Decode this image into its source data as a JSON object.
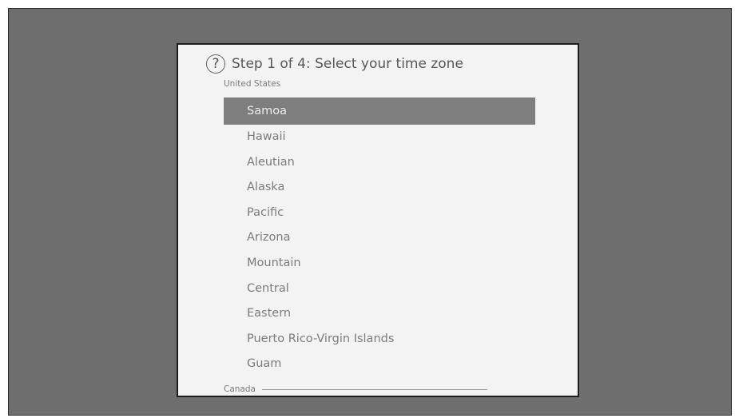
{
  "dialog": {
    "title": "Step 1 of 4: Select your time zone",
    "help_symbol": "?",
    "help_icon": "question-circle-icon"
  },
  "groups": {
    "united_states": {
      "label": "United States",
      "selected_index": 0,
      "items": [
        {
          "label": "Samoa"
        },
        {
          "label": "Hawaii"
        },
        {
          "label": "Aleutian"
        },
        {
          "label": "Alaska"
        },
        {
          "label": "Pacific"
        },
        {
          "label": "Arizona"
        },
        {
          "label": "Mountain"
        },
        {
          "label": "Central"
        },
        {
          "label": "Eastern"
        },
        {
          "label": "Puerto Rico-Virgin Islands"
        },
        {
          "label": "Guam"
        }
      ]
    },
    "canada": {
      "label": "Canada"
    }
  },
  "colors": {
    "screen_background": "#6e6e6e",
    "dialog_background": "#f3f3f3",
    "selection": "#7e7e7e",
    "text": "#7b7b7b"
  }
}
